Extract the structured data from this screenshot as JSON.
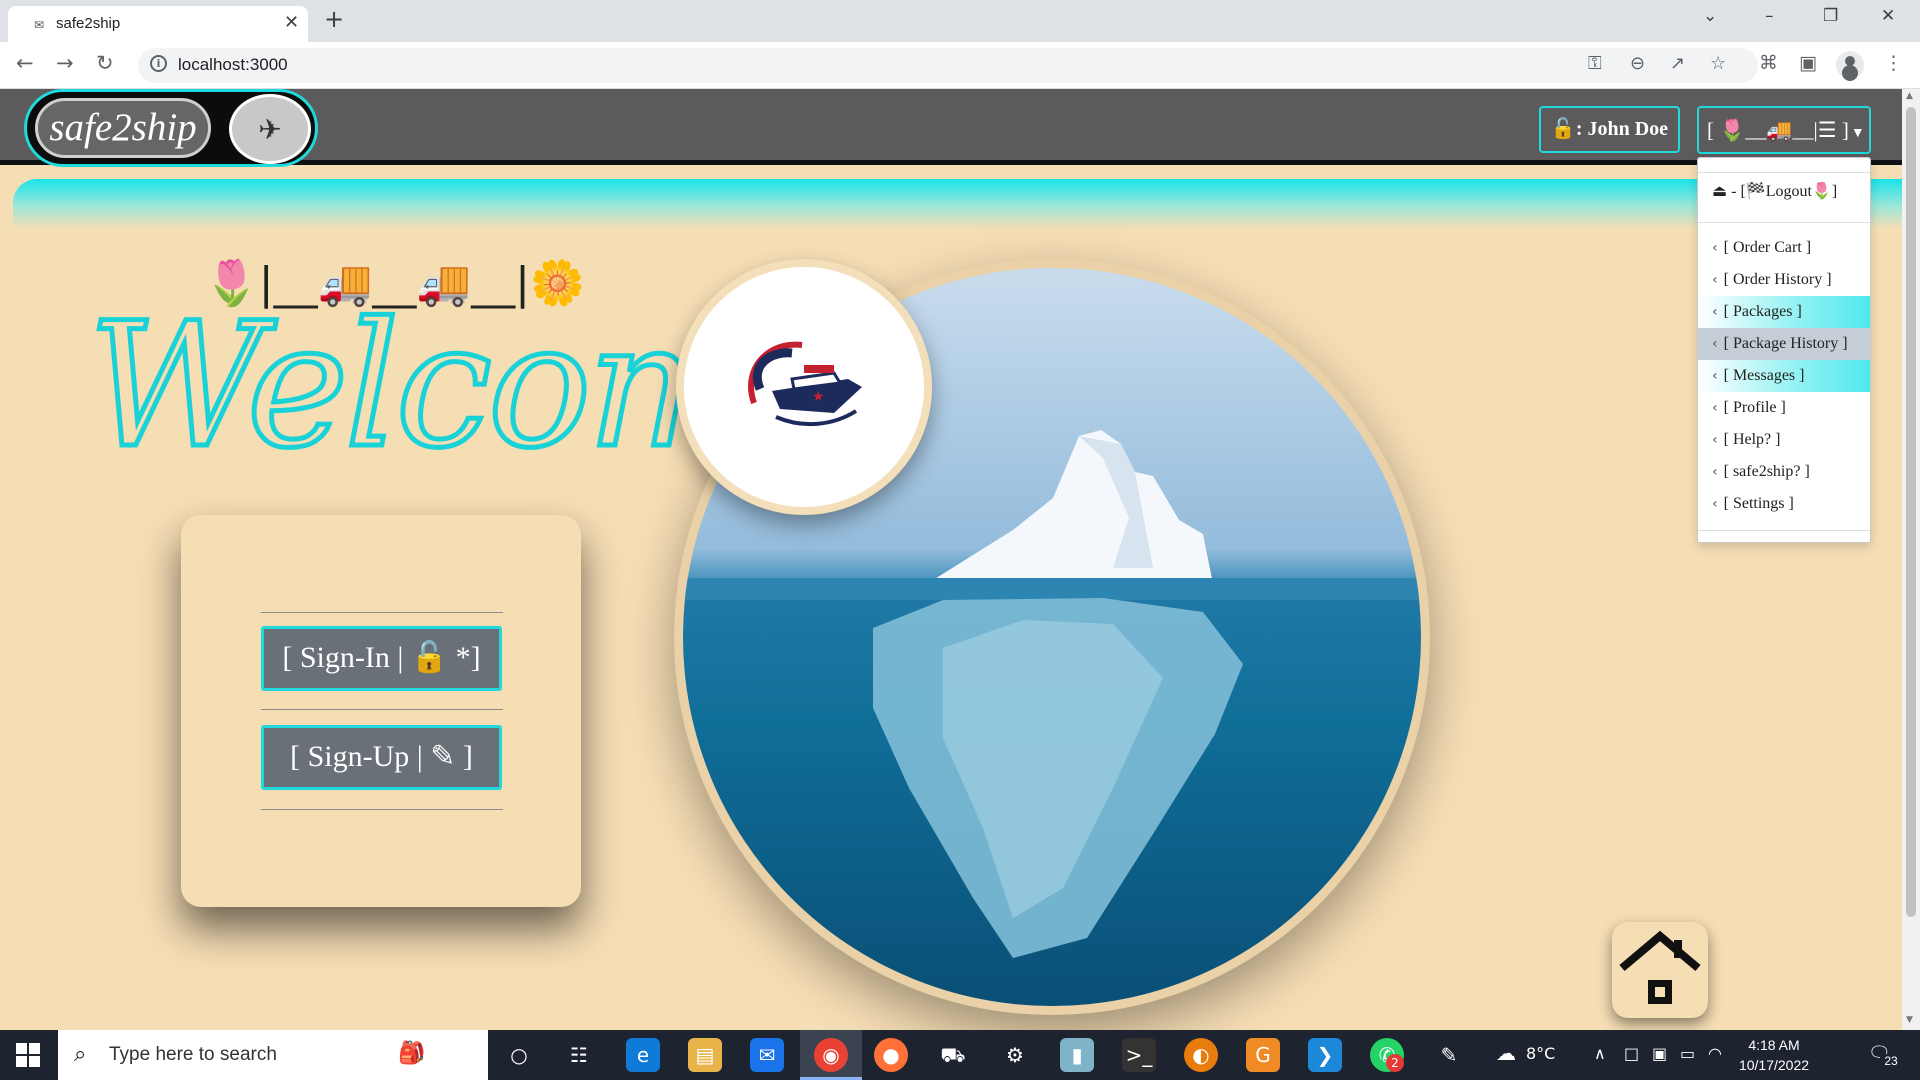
{
  "browser": {
    "tab_title": "safe2ship",
    "new_tab_icon": "+",
    "url": "localhost:3000",
    "icons": [
      "back-icon",
      "forward-icon",
      "reload-icon",
      "site-info-icon",
      "key-icon",
      "zoom-out-icon",
      "share-icon",
      "bookmark-star-icon",
      "extensions-icon",
      "side-panel-icon",
      "profile-icon",
      "menu-kebab-icon"
    ]
  },
  "header": {
    "brand_name": "safe2ship",
    "user_label": "🔓: John Doe",
    "menu_label": "[ 🌷__🚚__|☰ ]"
  },
  "hero": {
    "emoji_strip": "🌷|__🚚__🚚__|🌼",
    "welcome_text": "Welcome!"
  },
  "auth": {
    "sign_in_label": "[ Sign-In | 🔓 *]",
    "sign_up_label": "[ Sign-Up | ✎ ]"
  },
  "dropdown": {
    "logout_label": "⏏ - [🏁Logout🌷]",
    "items": [
      {
        "label": "[ Order Cart ]"
      },
      {
        "label": "[ Order History ]"
      },
      {
        "label": "[ Packages ]"
      },
      {
        "label": "[ Package History ]"
      },
      {
        "label": "[ Messages ]"
      },
      {
        "label": "[ Profile ]"
      },
      {
        "label": "[ Help? ]"
      },
      {
        "label": "[ safe2ship? ]"
      },
      {
        "label": "[ Settings ]"
      }
    ]
  },
  "taskbar": {
    "search_placeholder": "Type here to search",
    "weather": "8°C",
    "time": "4:18 AM",
    "date": "10/17/2022",
    "notification_count": "23",
    "whatsapp_badge": "2"
  },
  "colors": {
    "accent_cyan": "#1fd9dc",
    "page_beige": "#f5ddb4",
    "header_gray": "#5c5a5b",
    "button_gray": "#697078"
  }
}
